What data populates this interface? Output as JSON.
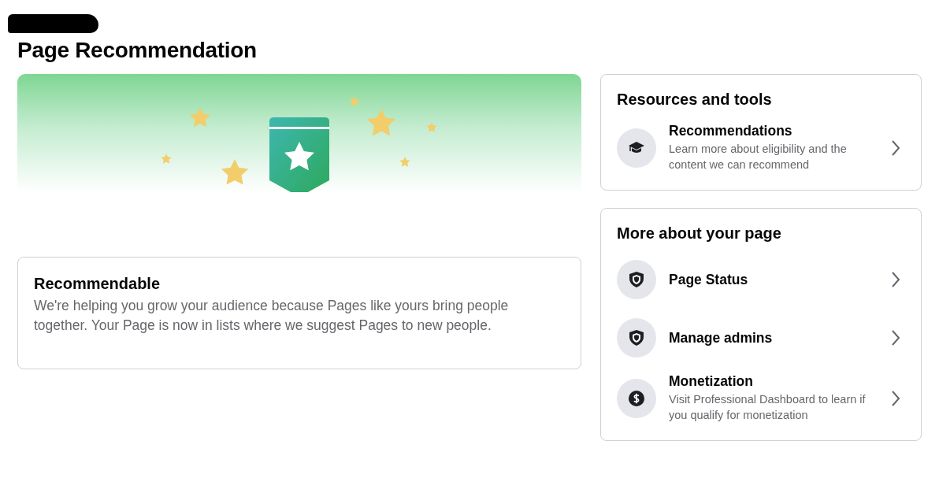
{
  "page": {
    "title": "Page Recommendation"
  },
  "status_card": {
    "title": "Recommendable",
    "text": "We're helping you grow your audience because Pages like yours bring people together. Your Page is now in lists where we suggest Pages to new people."
  },
  "panels": [
    {
      "title": "Resources and tools",
      "items": [
        {
          "title": "Recommendations",
          "subtitle": "Learn more about eligibility and the content we can recommend"
        }
      ]
    },
    {
      "title": "More about your page",
      "items": [
        {
          "title": "Page Status"
        },
        {
          "title": "Manage admins"
        },
        {
          "title": "Monetization",
          "subtitle": "Visit Professional Dashboard to learn if you qualify for monetization"
        }
      ]
    }
  ]
}
